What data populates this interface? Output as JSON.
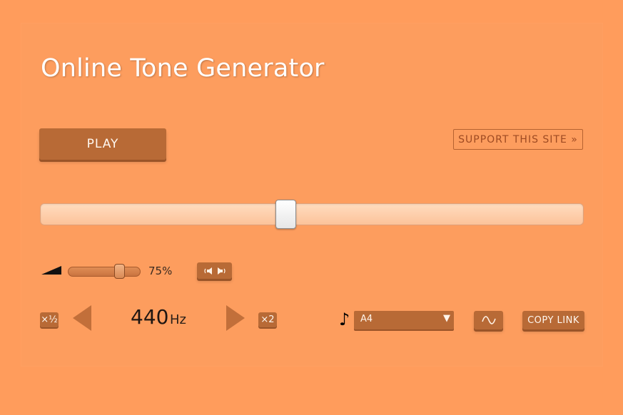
{
  "page": {
    "title": "Online Tone Generator"
  },
  "controls": {
    "play_label": "PLAY",
    "support_label": "SUPPORT THIS SITE »"
  },
  "frequency_slider": {
    "position_fraction": 0.45
  },
  "volume": {
    "level_fraction": 0.75,
    "display": "75%"
  },
  "frequency": {
    "half_label": "×½",
    "double_label": "×2",
    "value": "440",
    "unit": "Hz"
  },
  "note": {
    "icon": "♪",
    "selected": "A4",
    "dropdown_arrow": "▼"
  },
  "buttons": {
    "copy_link_label": "COPY LINK"
  },
  "colors": {
    "background": "#ff9c5c",
    "button": "#b86a36",
    "support_text": "#9e4a22"
  },
  "icons": {
    "volume": "volume-wedge-icon",
    "balance": "speaker-balance-icon",
    "waveform": "sine-wave-icon",
    "note": "music-note-icon"
  }
}
